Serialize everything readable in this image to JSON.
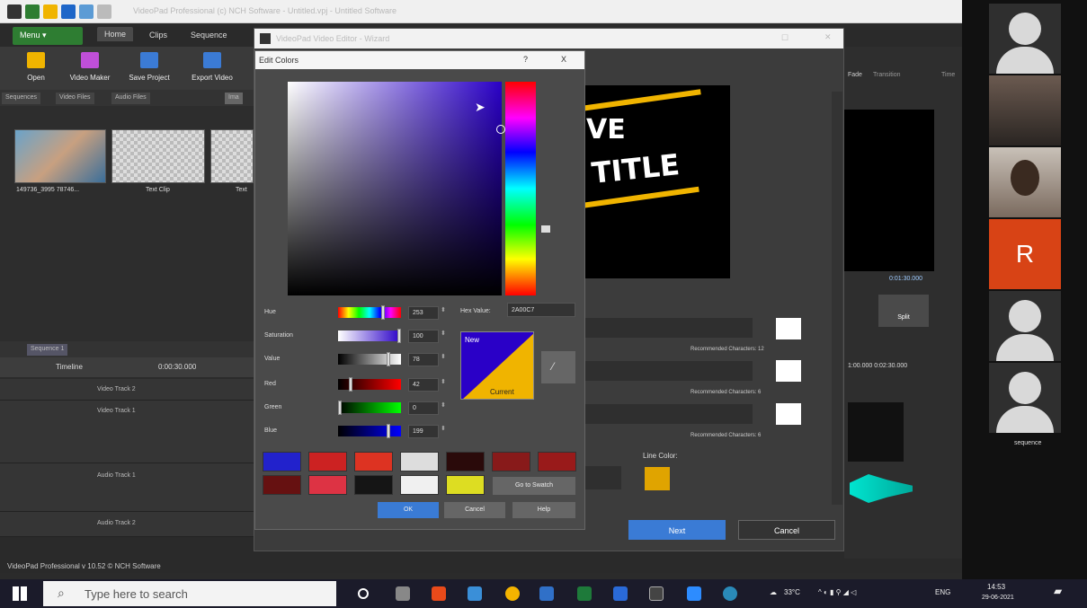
{
  "app": {
    "title": "VideoPad Professional (c) NCH Software - Untitled.vpj - Untitled Software",
    "menu_label": "Menu ▾",
    "tabs": [
      "Home",
      "Clips",
      "Sequence"
    ],
    "ribbon_buttons": [
      "Open",
      "Video Maker",
      "Save Project",
      "Export Video"
    ],
    "bin_tabs": [
      "Sequences",
      "Video Files",
      "Audio Files",
      "Ima"
    ],
    "media_items": [
      "149736_3995 78746...",
      "Text Clip",
      "Text"
    ],
    "sequence_tab": "Sequence 1",
    "timeline_label": "Timeline",
    "timeline_time": "0:00:30.000",
    "tracks": [
      "Video Track 2",
      "Video Track 1",
      "Audio Track 1",
      "Audio Track 2"
    ],
    "status_text": "VideoPad Professional v 10.52 © NCH Software",
    "right_labels": {
      "tab1": "Fade",
      "tab2": "Transition",
      "tab3": "Time"
    },
    "right_time1": "0:01:30.000",
    "right_split": "Split",
    "right_times": "1:00.000  0:02:30.000",
    "right_sequence": "sequence"
  },
  "wizard": {
    "title": "VideoPad Video Editor - Wizard",
    "recommended": [
      "Recommended Characters: 12",
      "Recommended Characters: 6",
      "Recommended Characters: 6"
    ],
    "line_color_label": "Line Color:",
    "line_color": "#e0a400",
    "next_button": "Next",
    "cancel_button": "Cancel",
    "preview_text": [
      "VE",
      "TITLE"
    ]
  },
  "edit_colors": {
    "title": "Edit Colors",
    "help_glyph": "?",
    "close_glyph": "X",
    "hex_label": "Hex Value:",
    "hex_value": "2A00C7",
    "channels": [
      {
        "label": "Hue",
        "value": "253"
      },
      {
        "label": "Saturation",
        "value": "100"
      },
      {
        "label": "Value",
        "value": "78"
      },
      {
        "label": "Red",
        "value": "42"
      },
      {
        "label": "Green",
        "value": "0"
      },
      {
        "label": "Blue",
        "value": "199"
      }
    ],
    "new_label": "New",
    "current_label": "Current",
    "new_color": "#2a00c7",
    "current_color": "#f0b400",
    "swatches_row1": [
      "#2222cc",
      "#cc2222",
      "#dd3322",
      "#dddddd",
      "#2a0a0a",
      "#881a1a",
      "#991a1a"
    ],
    "swatches_row2": [
      "#661111",
      "#dd3344",
      "#151515",
      "#f0f0f0",
      "#dddd22"
    ],
    "go_to_swatch": "Go to Swatch",
    "ok_button": "OK",
    "cancel_button": "Cancel",
    "help_button": "Help"
  },
  "participants": {
    "initial_tile": "R",
    "initial_color": "#d84315"
  },
  "taskbar": {
    "search_placeholder": "Type here to search",
    "weather": "33°C",
    "lang": "ENG",
    "time": "14:53",
    "date": "29-06-2021"
  }
}
